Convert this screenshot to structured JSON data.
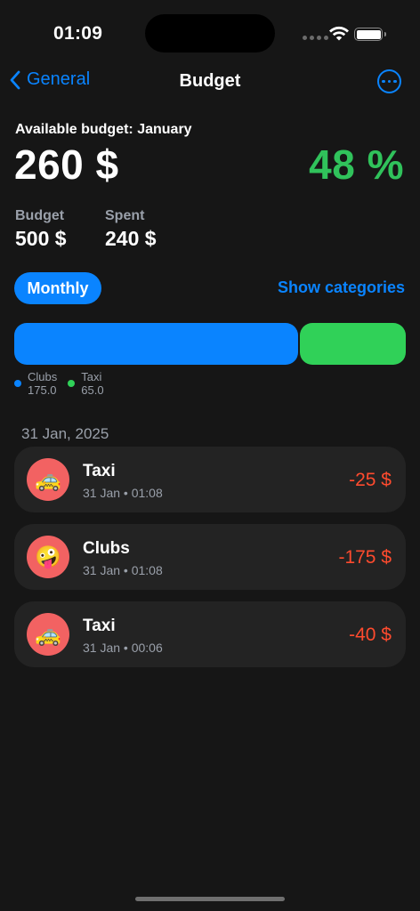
{
  "status_bar": {
    "time": "01:09"
  },
  "nav": {
    "back_label": "General",
    "title": "Budget"
  },
  "summary": {
    "available_label": "Available budget: January",
    "available_amount": "260 $",
    "percent": "48 %",
    "budget_label": "Budget",
    "budget_value": "500 $",
    "spent_label": "Spent",
    "spent_value": "240 $"
  },
  "controls": {
    "period": "Monthly",
    "show_categories": "Show categories"
  },
  "categories": [
    {
      "name": "Clubs",
      "value": "175.0",
      "amount": 175.0,
      "color": "#0a84ff"
    },
    {
      "name": "Taxi",
      "value": "65.0",
      "amount": 65.0,
      "color": "#30d158"
    }
  ],
  "transactions": {
    "date": "31 Jan, 2025",
    "items": [
      {
        "emoji": "🚕",
        "icon": "taxi-icon",
        "title": "Taxi",
        "subtitle": "31 Jan • 01:08",
        "amount": "-25 $"
      },
      {
        "emoji": "🤪",
        "icon": "zany-face-icon",
        "title": "Clubs",
        "subtitle": "31 Jan • 01:08",
        "amount": "-175 $"
      },
      {
        "emoji": "🚕",
        "icon": "taxi-icon",
        "title": "Taxi",
        "subtitle": "31 Jan • 00:06",
        "amount": "-40 $"
      }
    ]
  },
  "colors": {
    "accent": "#0a84ff",
    "positive": "#30c25b",
    "negative": "#ff4b2e",
    "avatar_bg": "#f26262"
  }
}
